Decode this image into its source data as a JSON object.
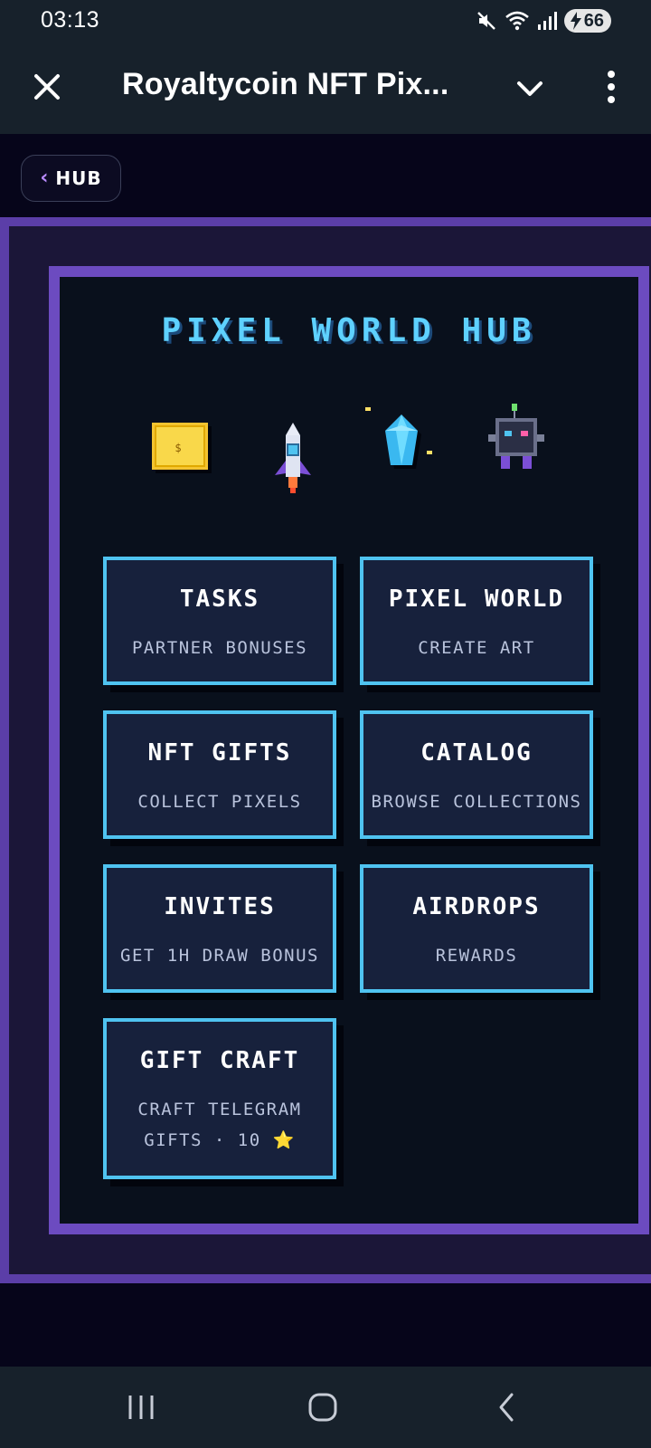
{
  "status_bar": {
    "time": "03:13",
    "battery": "66",
    "icons": [
      "mute-icon",
      "wifi-icon",
      "signal-icon",
      "battery-charging-icon"
    ]
  },
  "title_bar": {
    "title": "Royaltycoin NFT Pix...",
    "close_icon": "close-icon",
    "menu_icon": "chevron-down-icon",
    "more_icon": "more-vertical-icon"
  },
  "hub_back": {
    "label": "HUB",
    "arrow": "‹"
  },
  "hub": {
    "title": "PIXEL WORLD HUB",
    "decorations": [
      "coin-icon",
      "rocket-icon",
      "crystal-icon",
      "robot-icon"
    ],
    "coin_symbol": "$",
    "tiles": [
      {
        "title": "TASKS",
        "subtitle": "PARTNER BONUSES"
      },
      {
        "title": "PIXEL WORLD",
        "subtitle": "CREATE ART"
      },
      {
        "title": "NFT GIFTS",
        "subtitle": "COLLECT PIXELS"
      },
      {
        "title": "CATALOG",
        "subtitle": "BROWSE COLLECTIONS"
      },
      {
        "title": "INVITES",
        "subtitle": "GET 1H DRAW BONUS"
      },
      {
        "title": "AIRDROPS",
        "subtitle": "REWARDS"
      },
      {
        "title": "GIFT CRAFT",
        "subtitle_line1": "CRAFT TELEGRAM",
        "subtitle_line2": "GIFTS · 10 ⭐"
      }
    ]
  },
  "colors": {
    "accent": "#5ed1ff",
    "tile_border": "#4fc3f0",
    "frame_purple": "#6c4bc0",
    "panel_bg": "#09101c"
  },
  "bottom_nav": [
    "recents-icon",
    "home-icon",
    "back-icon"
  ]
}
